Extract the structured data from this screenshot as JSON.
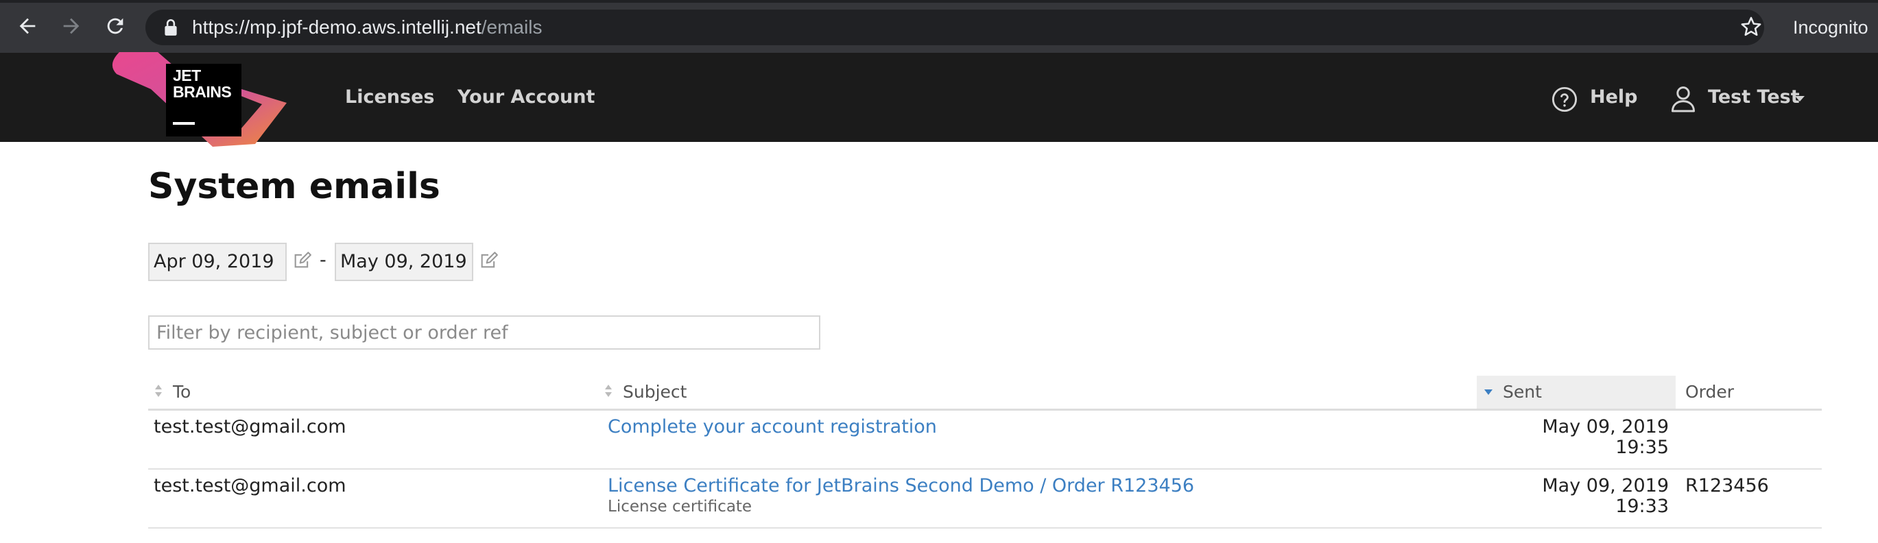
{
  "browser": {
    "url_host": "https://mp.jpf-demo.aws.intellij.net",
    "url_path": "/emails",
    "mode_label": "Incognito"
  },
  "header": {
    "logo_line1": "JET",
    "logo_line2": "BRAINS",
    "nav": [
      {
        "label": "Licenses"
      },
      {
        "label": "Your Account"
      }
    ],
    "help_label": "Help",
    "user_label": "Test Test"
  },
  "page": {
    "title": "System emails",
    "date_from": "Apr 09, 2019",
    "date_separator": "-",
    "date_to": "May 09, 2019",
    "filter_placeholder": "Filter by recipient, subject or order ref"
  },
  "table": {
    "columns": [
      "To",
      "Subject",
      "Sent",
      "Order"
    ],
    "sorted_column": "Sent",
    "rows": [
      {
        "to": "test.test@gmail.com",
        "subject": "Complete your account registration",
        "subject_note": "",
        "sent_date": "May 09, 2019",
        "sent_time": "19:35",
        "order": ""
      },
      {
        "to": "test.test@gmail.com",
        "subject": "License Certificate for JetBrains Second Demo / Order R123456",
        "subject_note": "License certificate",
        "sent_date": "May 09, 2019",
        "sent_time": "19:33",
        "order": "R123456"
      }
    ]
  },
  "colors": {
    "header_bg": "#1b1b1b",
    "link": "#3c7fc2",
    "sort_active": "#3c7fc2"
  }
}
